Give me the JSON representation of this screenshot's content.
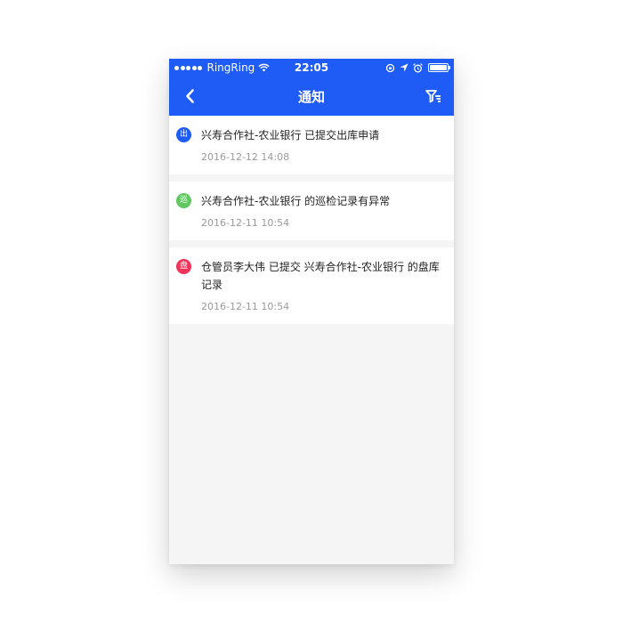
{
  "status_bar": {
    "carrier": "RingRing",
    "time": "22:05",
    "signal_icon": "signal-dots-icon",
    "wifi_icon": "wifi-icon",
    "battery_icon": "battery-icon"
  },
  "nav": {
    "title": "通知",
    "back_icon": "chevron-left-icon",
    "filter_icon": "filter-icon"
  },
  "colors": {
    "brand_blue": "#1f5cf5",
    "background": "#f5f5f5"
  },
  "notifications": [
    {
      "badge": "出",
      "badge_color": "#1f5cf5",
      "text": "兴寿合作社-农业银行 已提交出库申请",
      "time": "2016-12-12 14:08"
    },
    {
      "badge": "巡",
      "badge_color": "#5fc860",
      "text": "兴寿合作社-农业银行 的巡检记录有异常",
      "time": "2016-12-11 10:54"
    },
    {
      "badge": "盘",
      "badge_color": "#f0345a",
      "text": "仓管员李大伟 已提交 兴寿合作社-农业银行 的盘库记录",
      "time": "2016-12-11 10:54"
    }
  ]
}
